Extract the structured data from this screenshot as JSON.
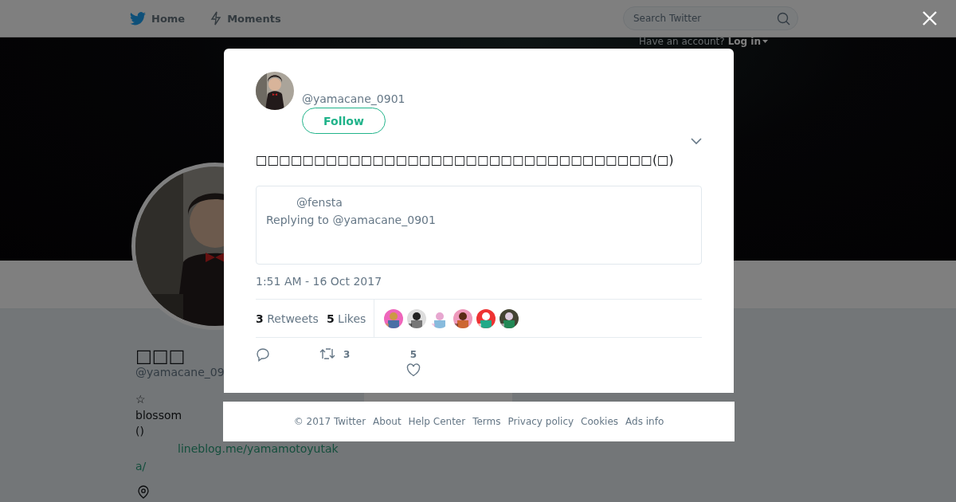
{
  "nav": {
    "items": [
      {
        "label": "Home"
      },
      {
        "label": "Moments"
      }
    ],
    "search": {
      "placeholder": "Search Twitter"
    },
    "account_prompt": "Have an account?",
    "login": "Log in"
  },
  "profile": {
    "name": "□□□",
    "handle": "@yamacane_09",
    "bio_lines": [
      "☆",
      "blossom",
      "()"
    ],
    "link_prefix": "lineblog.me/yamamotoyutak",
    "link_rest": "a/"
  },
  "tweet": {
    "handle": "@yamacane_0901",
    "follow_label": "Follow",
    "text": "□□□□□□□□□□□□□□□□□□□□□□□□□□□□□□□□□□(□)",
    "quote": {
      "handle": "@fensta",
      "reply_line": "Replying to @yamacane_0901"
    },
    "timestamp": "1:51 AM - 16 Oct 2017",
    "stats": [
      {
        "count": "3",
        "label": "Retweets"
      },
      {
        "count": "5",
        "label": "Likes"
      }
    ],
    "actions": [
      {
        "kind": "reply"
      },
      {
        "kind": "retweet",
        "count": "3"
      },
      {
        "kind": "like",
        "count": "5"
      }
    ]
  },
  "footer": [
    "© 2017 Twitter",
    "About",
    "Help Center",
    "Terms",
    "Privacy policy",
    "Cookies",
    "Ads info"
  ]
}
